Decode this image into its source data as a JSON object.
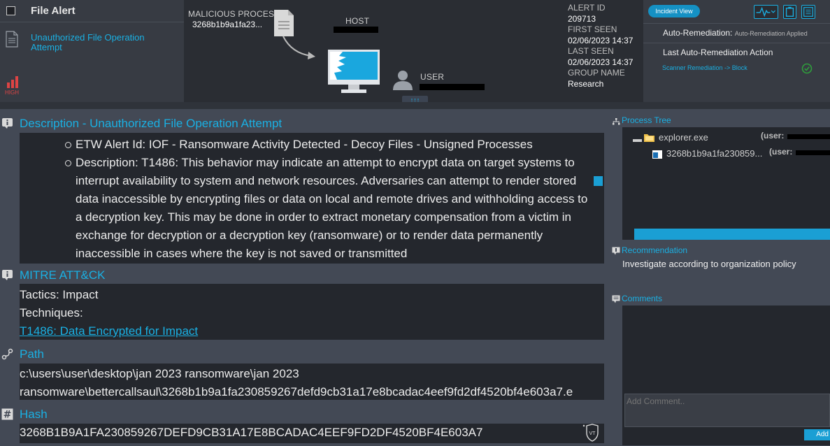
{
  "header": {
    "title": "File Alert",
    "alert_name": "Unauthorized File Operation Attempt",
    "severity": "HIGH",
    "malicious_process_label": "MALICIOUS PROCESS",
    "malicious_process_value": "3268b1b9a1fa23...",
    "host_label": "HOST",
    "user_label": "USER",
    "expand_label": "↑↑↑",
    "alert_id_label": "ALERT ID",
    "alert_id": "209713",
    "first_seen_label": "FIRST SEEN",
    "first_seen": "02/06/2023 14:37",
    "last_seen_label": "LAST SEEN",
    "last_seen": "02/06/2023 14:37",
    "group_name_label": "GROUP NAME",
    "group_name": "Research",
    "incident_view_label": "Incident View",
    "auto_remediation_label": "Auto-Remediation:",
    "auto_remediation_status": "Auto-Remediation Applied",
    "last_action_label": "Last Auto-Remediation Action",
    "last_action_value": "Scanner Remediation -> Block"
  },
  "description": {
    "title": "Description - Unauthorized File Operation Attempt",
    "items": [
      "ETW Alert Id: IOF - Ransomware Activity Detected - Decoy Files - Unsigned Processes",
      "Description: T1486: This behavior may indicate an attempt to encrypt data on target systems to interrupt availability to system and network resources. Adversaries can attempt to render stored data inaccessible by encrypting files or data on local and remote drives and withholding access to a decryption key. This may be done in order to extract monetary compensation from a victim in exchange for decryption or a decryption key (ransomware) or to render data permanently inaccessible in cases where the key is not saved or transmitted"
    ]
  },
  "mitre": {
    "title": "MITRE ATT&CK",
    "tactics": "Tactics: Impact",
    "techniques_label": "Techniques:",
    "technique_link": "T1486: Data Encrypted for Impact"
  },
  "path": {
    "title": "Path",
    "line1": "c:\\users\\user\\desktop\\jan 2023 ransomware\\jan 2023",
    "line2": "ransomware\\bettercallsaul\\3268b1b9a1fa230859267defd9cb31a17e8bcadac4eef9fd2df4520bf4e603a7.e"
  },
  "hash": {
    "title": "Hash",
    "value": "3268B1B9A1FA230859267DEFD9CB31A17E8BCADAC4EEF9FD2DF4520BF4E603A7",
    "vt_label": "VT"
  },
  "process_tree": {
    "title": "Process Tree",
    "parent": "explorer.exe",
    "parent_user": "(user:",
    "child": "3268b1b9a1fa230859...",
    "child_user": "(user:"
  },
  "recommendation": {
    "title": "Recommendation",
    "text": "Investigate according to organization policy"
  },
  "comments": {
    "title": "Comments",
    "placeholder": "Add Comment..",
    "add_label": "Add"
  },
  "colors": {
    "accent": "#1ab0e3",
    "severity_high": "#dd4444",
    "panel_bg": "#24272d",
    "page_bg": "#434955"
  }
}
